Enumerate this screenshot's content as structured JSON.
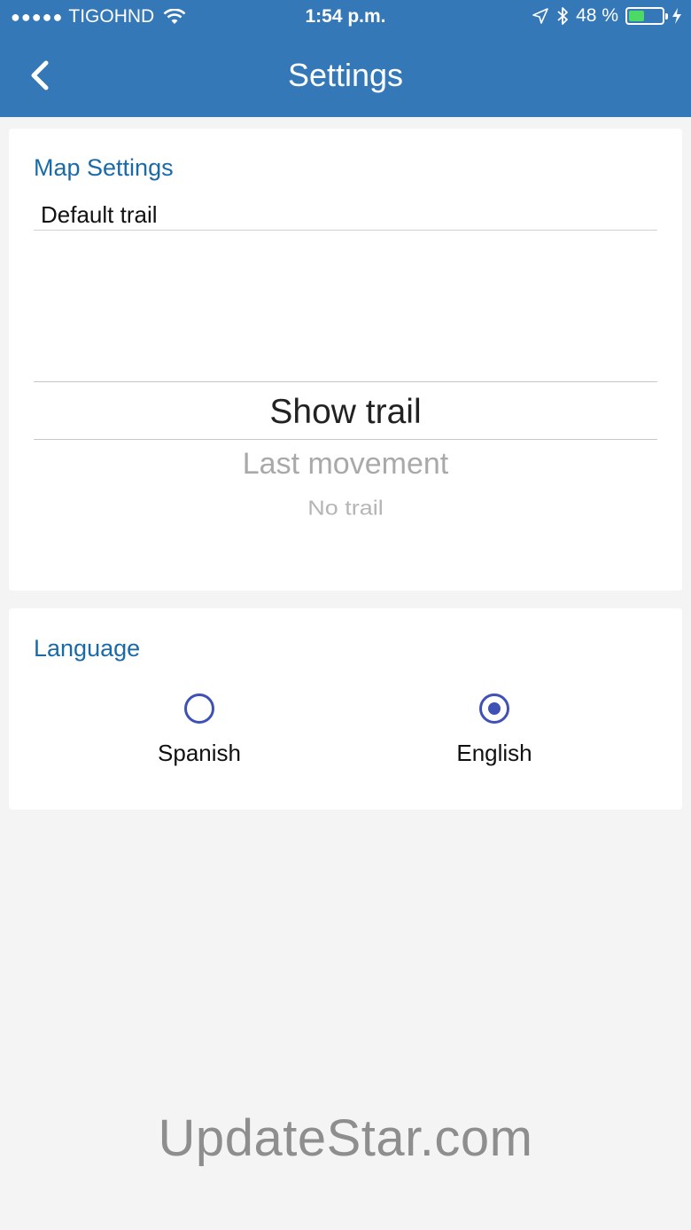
{
  "status_bar": {
    "signal_dots": "●●●●●",
    "carrier": "TIGOHND",
    "time": "1:54 p.m.",
    "battery_percent": "48 %",
    "battery_level": 0.48,
    "icons": [
      "wifi-icon",
      "location-arrow-icon",
      "bluetooth-icon",
      "battery-icon",
      "charging-bolt-icon"
    ]
  },
  "header": {
    "title": "Settings",
    "back_icon": "chevron-left-icon",
    "color": "#3478b8"
  },
  "map_settings": {
    "section_title": "Map Settings",
    "field_label": "Default trail",
    "picker": {
      "selected": "Show trail",
      "options": [
        "Show trail",
        "Last movement",
        "No trail"
      ]
    }
  },
  "language": {
    "section_title": "Language",
    "options": [
      {
        "label": "Spanish",
        "checked": false
      },
      {
        "label": "English",
        "checked": true
      }
    ],
    "radio_color": "#3f51b5"
  },
  "watermark": "UpdateStar.com"
}
